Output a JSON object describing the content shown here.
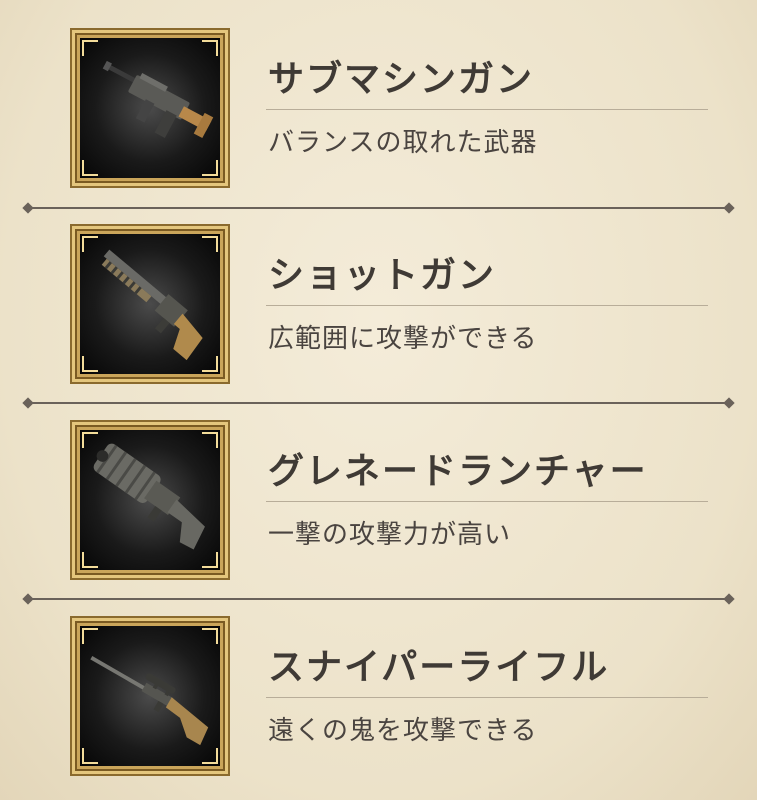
{
  "weapons": [
    {
      "name": "サブマシンガン",
      "description": "バランスの取れた武器",
      "icon": "submachine-gun-icon"
    },
    {
      "name": "ショットガン",
      "description": "広範囲に攻撃ができる",
      "icon": "shotgun-icon"
    },
    {
      "name": "グレネードランチャー",
      "description": "一撃の攻撃力が高い",
      "icon": "grenade-launcher-icon"
    },
    {
      "name": "スナイパーライフル",
      "description": "遠くの鬼を攻撃できる",
      "icon": "sniper-rifle-icon"
    }
  ]
}
